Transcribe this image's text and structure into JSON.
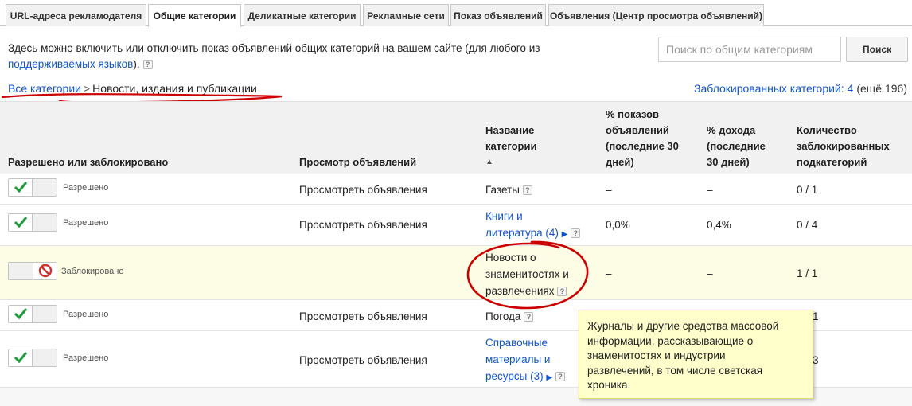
{
  "tabs": [
    {
      "label": "URL-адреса рекламодателя",
      "active": false
    },
    {
      "label": "Общие категории",
      "active": true
    },
    {
      "label": "Деликатные категории",
      "active": false
    },
    {
      "label": "Рекламные сети",
      "active": false
    },
    {
      "label": "Показ объявлений",
      "active": false
    },
    {
      "label": "Объявления (Центр просмотра объявлений)",
      "active": false
    }
  ],
  "intro": {
    "text_before": "Здесь можно включить или отключить показ объявлений общих категорий на вашем сайте (для любого из ",
    "link": "поддерживаемых языков",
    "text_after": ").",
    "help": "?"
  },
  "search": {
    "placeholder": "Поиск по общим категориям",
    "button": "Поиск"
  },
  "breadcrumb": {
    "root": "Все категории",
    "separator": ">",
    "current": "Новости, издания и публикации"
  },
  "blocked_summary": {
    "link": "Заблокированных категорий: 4",
    "rest": "(ещё 196)"
  },
  "table": {
    "headers": {
      "status": "Разрешено или заблокировано",
      "preview": "Просмотр объявлений",
      "name": [
        "Название",
        "категории"
      ],
      "sort": "▲",
      "impressions": [
        "% показов",
        "объявлений",
        "(последние 30",
        "дней)"
      ],
      "revenue": [
        "% дохода",
        "(последние",
        "30 дней)"
      ],
      "subcats": [
        "Количество",
        "заблокированных",
        "подкатегорий"
      ]
    },
    "rows": [
      {
        "status": "Разрешено",
        "preview": "",
        "name": [
          "Газеты"
        ],
        "name_link": false,
        "impressions": "–",
        "revenue": "–",
        "subcats": "0 / 1"
      },
      {
        "status": "Разрешено",
        "preview": "Просмотреть объявления",
        "name": [
          "Книги и",
          "литература (4)"
        ],
        "name_link": true,
        "impressions": "0,0%",
        "revenue": "0,4%",
        "subcats": "0 / 4"
      },
      {
        "status": "Заблокировано",
        "preview": "",
        "name": [
          "Новости о",
          "знаменитостях и",
          "развлечениях"
        ],
        "name_link": false,
        "impressions": "–",
        "revenue": "–",
        "subcats": "1 / 1"
      },
      {
        "status": "Разрешено",
        "preview": "Просмотреть объявления",
        "name": [
          "Погода"
        ],
        "name_link": false,
        "impressions": "",
        "revenue": "",
        "subcats": "1"
      },
      {
        "status": "Разрешено",
        "preview": "Просмотреть объявления",
        "name": [
          "Справочные",
          "материалы и",
          "ресурсы (3)"
        ],
        "name_link": true,
        "impressions": "",
        "revenue": "",
        "subcats": "3"
      }
    ],
    "row1_preview": "Просмотреть объявления"
  },
  "tooltip": {
    "lines": [
      "Журналы и другие средства массовой",
      "информации, рассказывающие о",
      "знаменитостях и индустрии",
      "развлечений, в том числе светская",
      "хроника."
    ]
  },
  "colors": {
    "link": "#1155cc",
    "check": "#1e9b3a",
    "block": "#d32f2f",
    "annotation": "#cc0000",
    "tooltip_bg": "#ffffcc"
  },
  "icons": {
    "allowed": "check-icon",
    "blocked": "no-entry-icon",
    "help": "help-icon",
    "expand": "triangle-right-icon"
  }
}
